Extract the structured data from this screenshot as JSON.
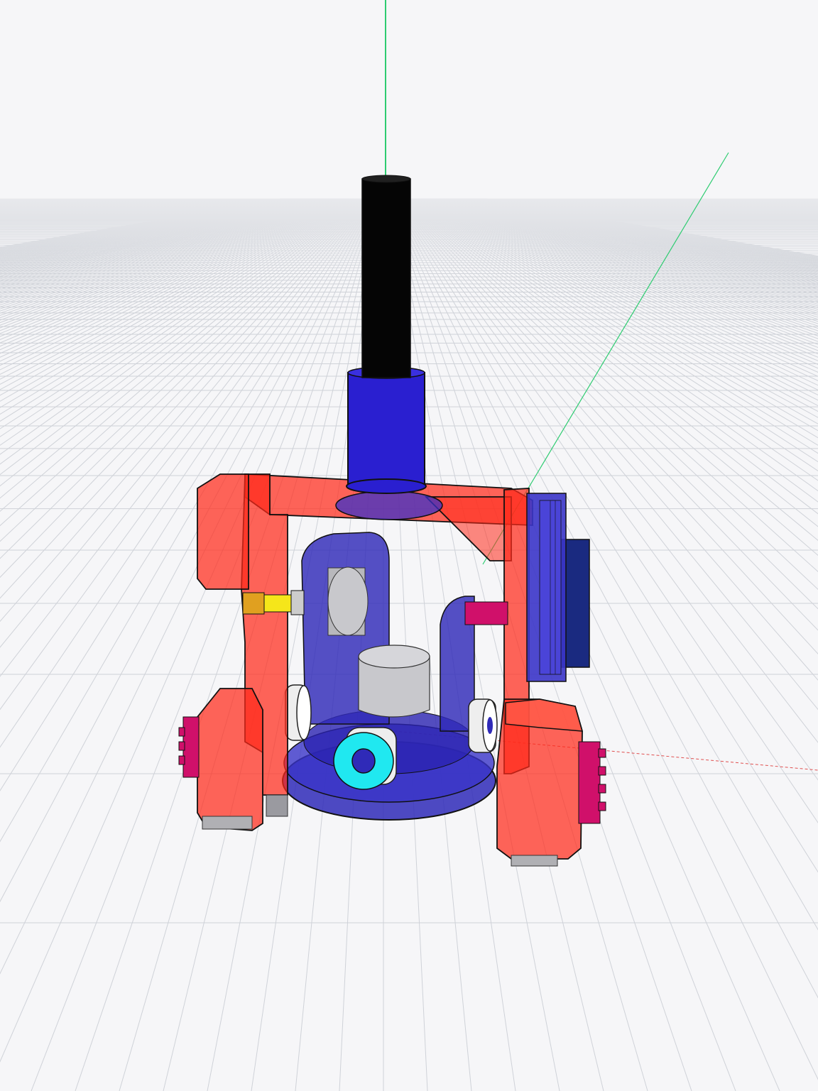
{
  "viewport": {
    "background": "#f6f6f8",
    "grid_color": "#cfd2d8",
    "axis_colors": {
      "x": "#e05050",
      "y": "#2ecc71",
      "z": "#2ecc71"
    }
  },
  "model": {
    "colors": {
      "frame_red": "#ff2a1a",
      "body_blue": "#2f2ab8",
      "rod_black": "#050505",
      "sleeve_blue": "#2a1fd0",
      "motor_gray": "#c8c8cc",
      "cyan_wheel": "#20e8f0",
      "yellow_shaft": "#f5e61a",
      "magenta_part": "#d0106a",
      "navy_board": "#1a2a80"
    }
  }
}
